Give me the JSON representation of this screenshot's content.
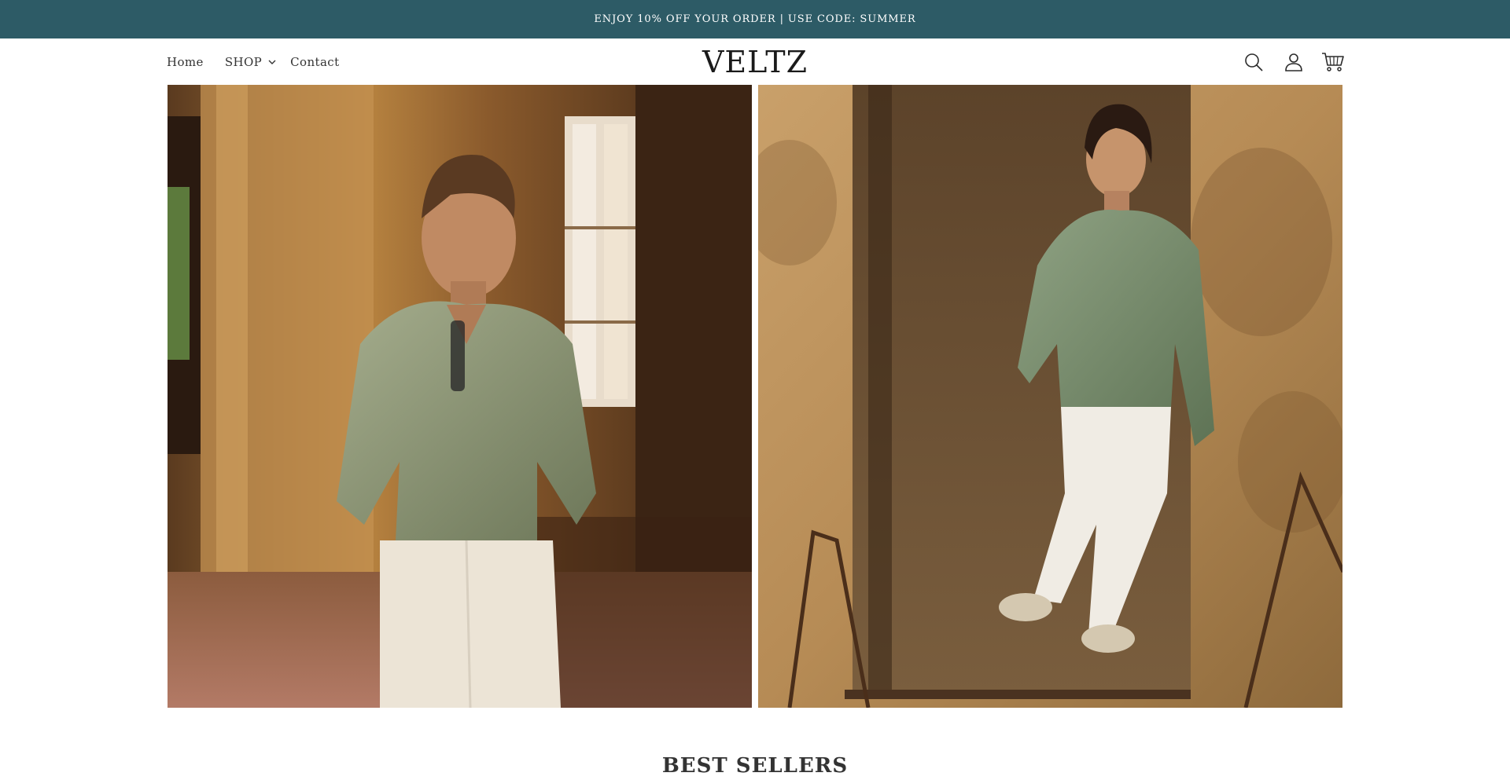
{
  "announcement": {
    "text": "ENJOY 10% OFF YOUR ORDER | USE CODE: SUMMER",
    "background": "#2d5b66"
  },
  "header": {
    "logo": "VELTZ",
    "nav": [
      {
        "label": "Home"
      },
      {
        "label": "SHOP",
        "has_dropdown": true
      },
      {
        "label": "Contact"
      }
    ],
    "icons": [
      "search-icon",
      "account-icon",
      "cart-icon"
    ]
  },
  "hero": {
    "images": [
      {
        "description": "man-in-sage-linen-shirt-leaning-on-pillar"
      },
      {
        "description": "man-in-green-polo-leaning-in-doorway"
      }
    ]
  },
  "sections": {
    "best_sellers_title": "BEST SELLERS"
  },
  "colors": {
    "accent": "#2d5b66",
    "text": "#333333",
    "shirt_green": "#8a9672",
    "terracotta": "#b57a45"
  }
}
